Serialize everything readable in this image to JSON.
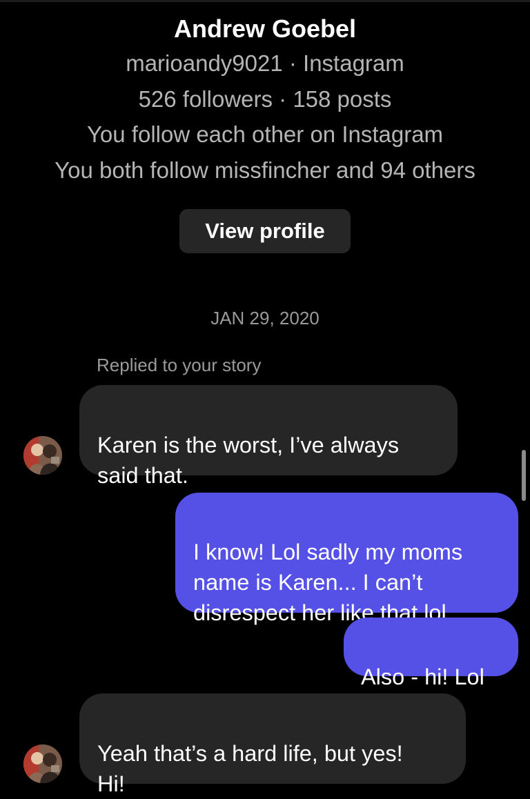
{
  "profile": {
    "name": "Andrew Goebel",
    "username_line": "marioandy9021 · Instagram",
    "stats_line": "526 followers · 158 posts",
    "follow_status": "You follow each other on Instagram",
    "mutual_follow": "You both follow missfincher and 94 others",
    "view_profile_label": "View profile"
  },
  "conversation": {
    "date": "JAN 29, 2020",
    "reply_label": "Replied to your story",
    "messages": [
      {
        "sender": "them",
        "text": "Karen is the worst, I’ve always\nsaid that."
      },
      {
        "sender": "me",
        "text": "I know! Lol sadly my moms\nname is Karen... I can’t\ndisrespect her like that lol."
      },
      {
        "sender": "me",
        "text": "Also - hi! Lol"
      },
      {
        "sender": "them",
        "text": "Yeah that’s a hard life, but yes!\nHi!"
      }
    ]
  },
  "colors": {
    "background": "#000000",
    "incoming_bubble": "#262626",
    "outgoing_bubble": "#5551e6",
    "secondary_text": "#b5b5b5"
  },
  "icons": {
    "avatar": "user-photo-avatar"
  }
}
